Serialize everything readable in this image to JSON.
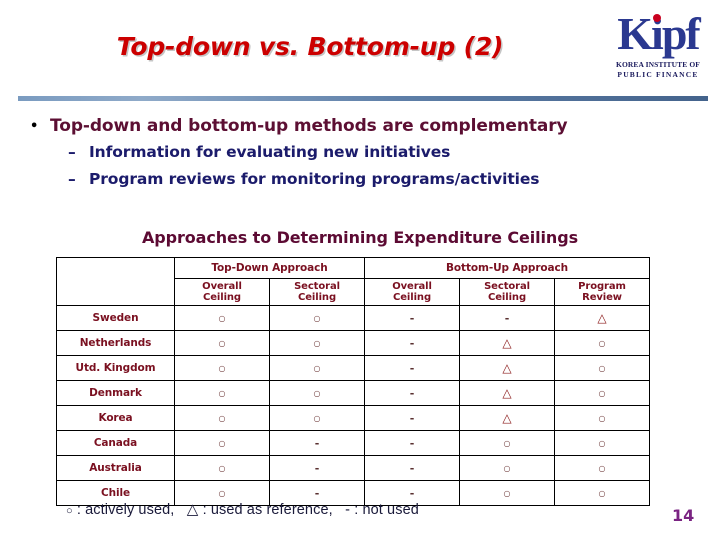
{
  "slide": {
    "title": "Top-down vs. Bottom-up (2)",
    "page_number": "14",
    "title_color": "#CC0000",
    "accent_color": "#5C0A33",
    "divider_color": "#5E7FA8"
  },
  "logo": {
    "mark": "Kipf",
    "line1": "KOREA INSTITUTE OF",
    "line2": "PUBLIC  FINANCE",
    "mark_color": "#2B3990",
    "dot_color": "#C9001F"
  },
  "bullets": {
    "level1": {
      "marker": "•",
      "text": "Top-down and bottom-up methods are complementary"
    },
    "level2": [
      {
        "marker": "–",
        "text": "Information for evaluating new initiatives"
      },
      {
        "marker": "–",
        "text": "Program reviews for monitoring programs/activities"
      }
    ]
  },
  "table": {
    "caption": "Approaches to Determining Expenditure Ceilings",
    "group_headers": [
      {
        "label": "",
        "span": 1
      },
      {
        "label": "Top-Down Approach",
        "span": 2
      },
      {
        "label": "Bottom-Up Approach",
        "span": 3
      }
    ],
    "sub_headers": [
      "Overall\nCeiling",
      "Sectoral\nCeiling",
      "Overall\nCeiling",
      "Sectoral\nCeiling",
      "Program\nReview"
    ],
    "sub_headers_l1": [
      "Overall",
      "Sectoral",
      "Overall",
      "Sectoral",
      "Program"
    ],
    "sub_headers_l2": [
      "Ceiling",
      "Ceiling",
      "Ceiling",
      "Ceiling",
      "Review"
    ],
    "rows": [
      {
        "country": "Sweden",
        "marks": [
          "circle",
          "circle",
          "dash",
          "dash",
          "triangle"
        ]
      },
      {
        "country": "Netherlands",
        "marks": [
          "circle",
          "circle",
          "dash",
          "triangle",
          "circle"
        ]
      },
      {
        "country": "Utd. Kingdom",
        "marks": [
          "circle",
          "circle",
          "dash",
          "triangle",
          "circle"
        ]
      },
      {
        "country": "Denmark",
        "marks": [
          "circle",
          "circle",
          "dash",
          "triangle",
          "circle"
        ]
      },
      {
        "country": "Korea",
        "marks": [
          "circle",
          "circle",
          "dash",
          "triangle",
          "circle"
        ]
      },
      {
        "country": "Canada",
        "marks": [
          "circle",
          "dash",
          "dash",
          "circle",
          "circle"
        ]
      },
      {
        "country": "Australia",
        "marks": [
          "circle",
          "dash",
          "dash",
          "circle",
          "circle"
        ]
      },
      {
        "country": "Chile",
        "marks": [
          "circle",
          "dash",
          "dash",
          "circle",
          "circle"
        ]
      }
    ],
    "symbols": {
      "circle": "○",
      "triangle": "△",
      "dash": "-"
    }
  },
  "legend": {
    "items": [
      {
        "symbol": "○",
        "text": ": actively used,"
      },
      {
        "symbol": "△",
        "text": ": used as reference,"
      },
      {
        "symbol": "-",
        "text": ": not used"
      }
    ],
    "full_text": "○ : actively used,  △ : used as reference,  - : not used"
  }
}
